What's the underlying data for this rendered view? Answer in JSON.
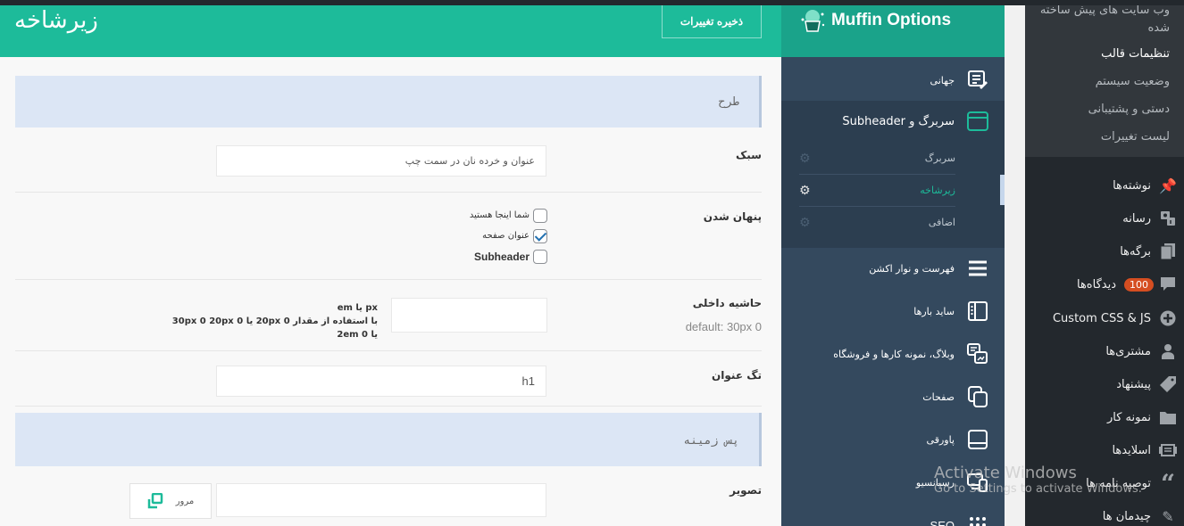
{
  "header": {
    "title": "زیرشاخه",
    "save_label": "ذخیره تغییرات"
  },
  "sections": {
    "layout": "طرح",
    "background": "پس زمینه"
  },
  "fields": {
    "style": {
      "label": "سبک",
      "value": "عنوان و خرده نان در سمت چپ"
    },
    "hide": {
      "label": "پنهان شدن",
      "options": [
        {
          "label": "شما اینجا هستید",
          "checked": false
        },
        {
          "label": "عنوان صفحه",
          "checked": true
        },
        {
          "label": "Subheader",
          "checked": false
        }
      ]
    },
    "padding": {
      "label": "حاشیه داخلی",
      "desc": "default: 30px 0",
      "value": "",
      "hint_line1": "px یا em",
      "hint_line2": "با استفاده از مقدار 0 20px یا 0 30px 0 20px یا 0 2em"
    },
    "title_tag": {
      "label": "تگ عنوان",
      "value": "h1"
    },
    "image": {
      "label": "تصویر",
      "value": "",
      "browse_label": "مرور"
    }
  },
  "muffin": {
    "brand": "Muffin Options",
    "nav": [
      {
        "label": "جهانی",
        "icon": "edit-document-icon"
      },
      {
        "label": "سربرگ و Subheader",
        "icon": "window-icon",
        "open": true
      },
      {
        "label": "فهرست و نوار اکشن",
        "icon": "hamburger-menu-icon"
      },
      {
        "label": "ساید بارها",
        "icon": "sidebar-layout-icon"
      },
      {
        "label": "وبلاگ، نمونه کارها و فروشگاه",
        "icon": "blog-portfolio-icon"
      },
      {
        "label": "صفحات",
        "icon": "pages-copy-icon"
      },
      {
        "label": "پاورقی",
        "icon": "footer-layout-icon"
      },
      {
        "label": "رسپانسیو",
        "icon": "responsive-devices-icon"
      },
      {
        "label": "SEO",
        "icon": "seo-dots-icon"
      }
    ],
    "subnav": [
      {
        "label": "سربرگ",
        "active": false
      },
      {
        "label": "زیرشاخه",
        "active": true
      },
      {
        "label": "اضافی",
        "active": false
      }
    ]
  },
  "wp_menu": {
    "submenu": [
      {
        "label": "وب سایت های پیش ساخته شده"
      },
      {
        "label": "تنظیمات قالب",
        "current": true
      },
      {
        "label": "وضعیت سیستم"
      },
      {
        "label": "دستی و پشتیبانی"
      },
      {
        "label": "لیست تغییرات"
      }
    ],
    "items": [
      {
        "label": "نوشته‌ها",
        "icon": "pushpin-icon"
      },
      {
        "label": "رسانه",
        "icon": "media-icon"
      },
      {
        "label": "برگه‌ها",
        "icon": "pages-icon"
      },
      {
        "label": "دیدگاه‌ها",
        "icon": "comment-icon",
        "badge": "100"
      },
      {
        "label": "Custom CSS & JS",
        "icon": "plus-circle-icon"
      },
      {
        "label": "مشتری‌ها",
        "icon": "user-icon"
      },
      {
        "label": "پیشنهاد",
        "icon": "tag-icon"
      },
      {
        "label": "نمونه کار",
        "icon": "folder-icon"
      },
      {
        "label": "اسلایدها",
        "icon": "slides-icon"
      },
      {
        "label": "توصیه نامه ها",
        "icon": "quote-icon"
      },
      {
        "label": "چیدمان ها",
        "icon": "pencil-icon"
      }
    ]
  },
  "watermark": {
    "line1": "Activate Windows",
    "line2": "Go to Settings to activate Windows."
  }
}
